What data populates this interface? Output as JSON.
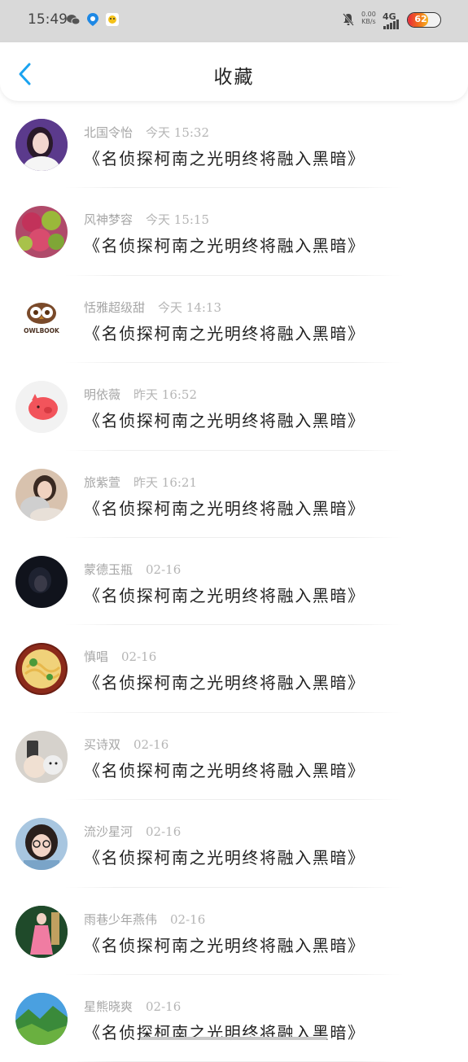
{
  "status_bar": {
    "time": "15:49",
    "net_speed_value": "0.00",
    "net_speed_unit": "KB/s",
    "network": "4G",
    "battery": "62",
    "battery_level": 0.62,
    "icons": [
      "wechat-icon",
      "map-pin-icon",
      "app-icon",
      "mute-bell-icon",
      "signal-icon"
    ]
  },
  "header": {
    "title": "收藏",
    "back_icon": "chevron-left-icon",
    "accent": "#1aa3f0"
  },
  "items": [
    {
      "name": "北国令怡",
      "time": "今天 15:32",
      "text": "《名侦探柯南之光明终将融入黑暗》",
      "avatar": "avatar-girl-purple"
    },
    {
      "name": "风神梦容",
      "time": "今天 15:15",
      "text": "《名侦探柯南之光明终将融入黑暗》",
      "avatar": "avatar-rambutan"
    },
    {
      "name": "恬雅超级甜",
      "time": "今天 14:13",
      "text": "《名侦探柯南之光明终将融入黑暗》",
      "avatar": "avatar-owlbook",
      "logo_text": "OWLBOOK"
    },
    {
      "name": "明依薇",
      "time": "昨天 16:52",
      "text": "《名侦探柯南之光明终将融入黑暗》",
      "avatar": "avatar-pig"
    },
    {
      "name": "旅紫萱",
      "time": "昨天 16:21",
      "text": "《名侦探柯南之光明终将融入黑暗》",
      "avatar": "avatar-girl-cat"
    },
    {
      "name": "蒙德玉瓶",
      "time": "02-16",
      "text": "《名侦探柯南之光明终将融入黑暗》",
      "avatar": "avatar-dark"
    },
    {
      "name": "慎唱",
      "time": "02-16",
      "text": "《名侦探柯南之光明终将融入黑暗》",
      "avatar": "avatar-noodles"
    },
    {
      "name": "买诗双",
      "time": "02-16",
      "text": "《名侦探柯南之光明终将融入黑暗》",
      "avatar": "avatar-selfie-dog"
    },
    {
      "name": "流沙星河",
      "time": "02-16",
      "text": "《名侦探柯南之光明终将融入黑暗》",
      "avatar": "avatar-girl-glasses"
    },
    {
      "name": "雨巷少年燕伟",
      "time": "02-16",
      "text": "《名侦探柯南之光明终将融入黑暗》",
      "avatar": "avatar-girl-pink"
    },
    {
      "name": "星熊晓爽",
      "time": "02-16",
      "text": "《名侦探柯南之光明终将融入黑暗》",
      "avatar": "avatar-landscape"
    }
  ]
}
